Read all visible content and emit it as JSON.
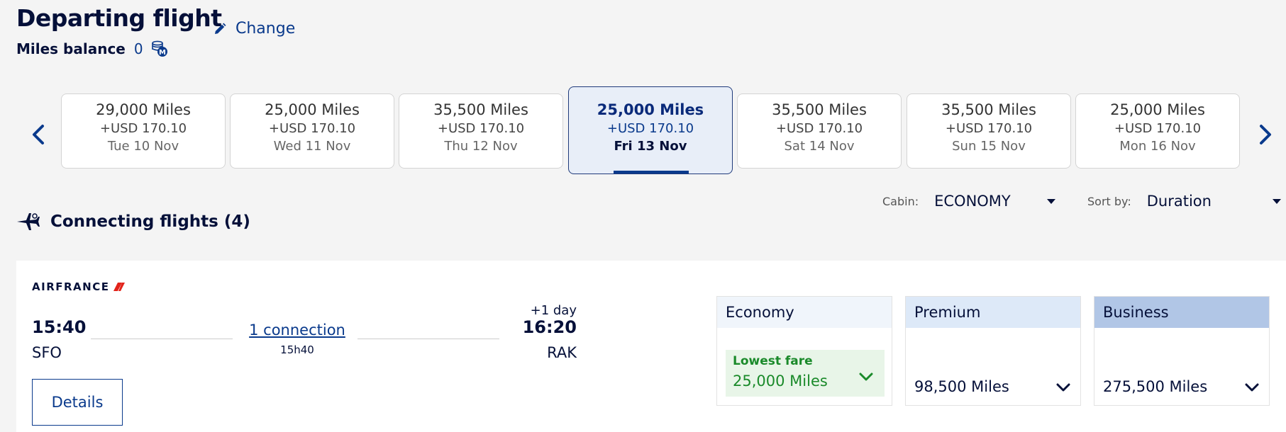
{
  "header": {
    "title": "Departing flight",
    "change_label": "Change",
    "miles_balance_label": "Miles balance",
    "miles_balance_value": "0"
  },
  "dates": [
    {
      "miles": "29,000 Miles",
      "usd": "+USD 170.10",
      "date": "Tue 10 Nov",
      "active": false
    },
    {
      "miles": "25,000 Miles",
      "usd": "+USD 170.10",
      "date": "Wed 11 Nov",
      "active": false
    },
    {
      "miles": "35,500 Miles",
      "usd": "+USD 170.10",
      "date": "Thu 12 Nov",
      "active": false
    },
    {
      "miles": "25,000 Miles",
      "usd": "+USD 170.10",
      "date": "Fri 13 Nov",
      "active": true
    },
    {
      "miles": "35,500 Miles",
      "usd": "+USD 170.10",
      "date": "Sat 14 Nov",
      "active": false
    },
    {
      "miles": "35,500 Miles",
      "usd": "+USD 170.10",
      "date": "Sun 15 Nov",
      "active": false
    },
    {
      "miles": "25,000 Miles",
      "usd": "+USD 170.10",
      "date": "Mon 16 Nov",
      "active": false
    }
  ],
  "filters": {
    "cabin_label": "Cabin:",
    "cabin_value": "ECONOMY",
    "sort_label": "Sort by:",
    "sort_value": "Duration"
  },
  "results": {
    "title": "Connecting flights (4)"
  },
  "flight": {
    "airline": "AIRFRANCE",
    "depart_time": "15:40",
    "depart_code": "SFO",
    "connection_label": "1 connection",
    "duration": "15h40",
    "plus_day": "+1 day",
    "arrive_time": "16:20",
    "arrive_code": "RAK",
    "details_label": "Details"
  },
  "fares": {
    "economy": {
      "label": "Economy",
      "badge": "Lowest fare",
      "price": "25,000 Miles",
      "header_color": "#f0f5fb"
    },
    "premium": {
      "label": "Premium",
      "price": "98,500 Miles",
      "header_color": "#dde9f8"
    },
    "business": {
      "label": "Business",
      "price": "275,500 Miles",
      "header_color": "#b1c6e6"
    }
  }
}
